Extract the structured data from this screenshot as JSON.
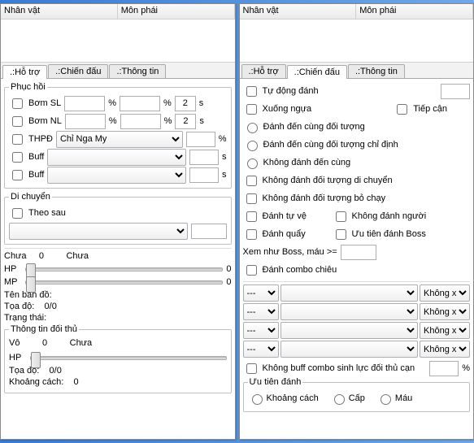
{
  "left": {
    "cols": {
      "char": "Nhân vật",
      "sect": "Môn phái"
    },
    "tabs": {
      "support": ".:Hỗ trợ",
      "combat": ".:Chiến đấu",
      "info": ".:Thông tin"
    },
    "recovery": {
      "title": "Phục hồi",
      "sl": "Bơm SL",
      "nl": "Bơm NL",
      "thpd": "THPĐ",
      "thpd_value": "Chỉ Nga My",
      "buff": "Buff",
      "pct": "%",
      "s": "s",
      "val2": "2"
    },
    "move": {
      "title": "Di chuyển",
      "follow": "Theo sau"
    },
    "status": {
      "chua": "Chưa",
      "hp": "HP",
      "mp": "MP",
      "zero": "0",
      "map_label": "Tên bản đồ:",
      "coord_label": "Tọa độ:",
      "coord": "0/0",
      "state_label": "Trạng thái:"
    },
    "enemy": {
      "title": "Thông tin đối thủ",
      "vo": "Vô",
      "zero": "0",
      "chua": "Chưa",
      "hp": "HP",
      "coord_label": "Tọa độ:",
      "coord": "0/0",
      "dist_label": "Khoảng cách:",
      "dist": "0"
    }
  },
  "right": {
    "cols": {
      "char": "Nhân vật",
      "sect": "Môn phái"
    },
    "tabs": {
      "support": ".:Hỗ trợ",
      "combat": ".:Chiến đấu",
      "info": ".:Thông tin"
    },
    "auto": "Tự động đánh",
    "dismount": "Xuống ngựa",
    "approach": "Tiếp cận",
    "hit_until": "Đánh đến cùng đối tượng",
    "hit_until_fixed": "Đánh đến cùng đối tượng chỉ định",
    "not_until": "Không đánh đến cùng",
    "not_moving": "Không đánh đối tượng di chuyển",
    "not_flee": "Không đánh đối tượng bỏ chạy",
    "self_def": "Đánh tự vệ",
    "no_player": "Không đánh người",
    "spin": "Đánh quẩy",
    "boss_first": "Ưu tiên đánh Boss",
    "boss_hp_label": "Xem như Boss, máu >=",
    "combo_hit": "Đánh combo chiêu",
    "dash": "---",
    "nongx": "Không x",
    "nobuff_combo": "Không buff combo sinh lực đối thủ cạn",
    "pct": "%",
    "prio": {
      "title": "Ưu tiên đánh",
      "dist": "Khoảng cách",
      "lvl": "Cấp",
      "hp": "Máu"
    }
  }
}
